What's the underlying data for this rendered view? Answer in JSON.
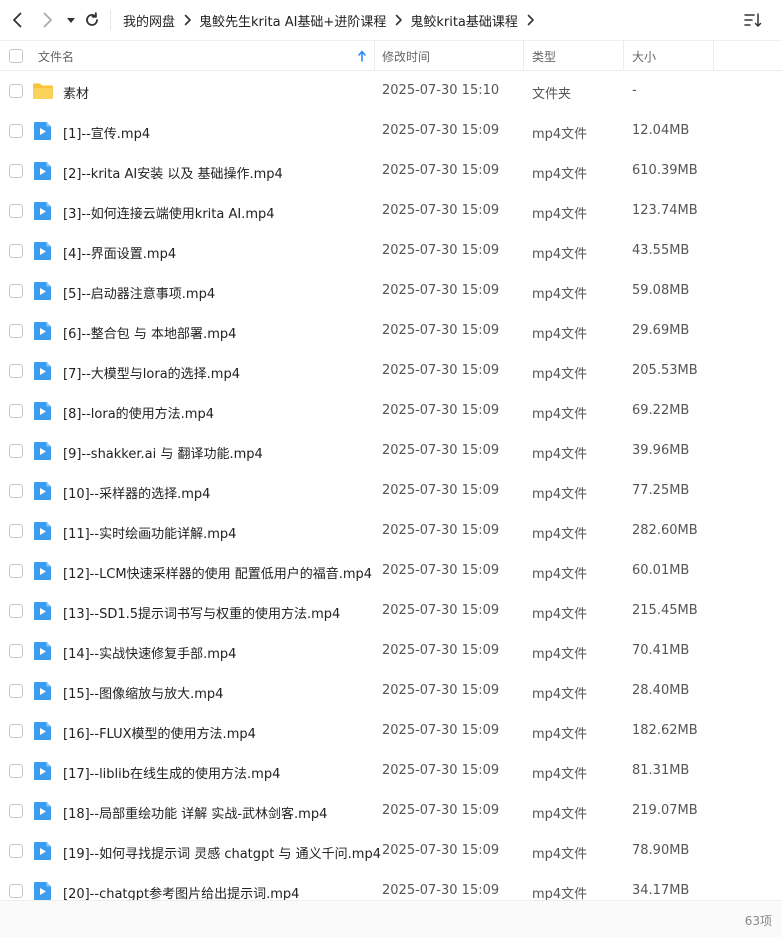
{
  "toolbar": {
    "breadcrumb": [
      "我的网盘",
      "鬼鲛先生krita AI基础+进阶课程",
      "鬼鲛krita基础课程"
    ]
  },
  "columns": {
    "name": "文件名",
    "date": "修改时间",
    "type": "类型",
    "size": "大小"
  },
  "files": [
    {
      "name": "素材",
      "date": "2025-07-30 15:10",
      "type": "文件夹",
      "size": "-",
      "icon": "folder-icon"
    },
    {
      "name": "[1]--宣传.mp4",
      "date": "2025-07-30 15:09",
      "type": "mp4文件",
      "size": "12.04MB",
      "icon": "video-file-icon"
    },
    {
      "name": "[2]--krita AI安装 以及 基础操作.mp4",
      "date": "2025-07-30 15:09",
      "type": "mp4文件",
      "size": "610.39MB",
      "icon": "video-file-icon"
    },
    {
      "name": "[3]--如何连接云端使用krita AI.mp4",
      "date": "2025-07-30 15:09",
      "type": "mp4文件",
      "size": "123.74MB",
      "icon": "video-file-icon"
    },
    {
      "name": "[4]--界面设置.mp4",
      "date": "2025-07-30 15:09",
      "type": "mp4文件",
      "size": "43.55MB",
      "icon": "video-file-icon"
    },
    {
      "name": "[5]--启动器注意事项.mp4",
      "date": "2025-07-30 15:09",
      "type": "mp4文件",
      "size": "59.08MB",
      "icon": "video-file-icon"
    },
    {
      "name": "[6]--整合包 与 本地部署.mp4",
      "date": "2025-07-30 15:09",
      "type": "mp4文件",
      "size": "29.69MB",
      "icon": "video-file-icon"
    },
    {
      "name": "[7]--大模型与lora的选择.mp4",
      "date": "2025-07-30 15:09",
      "type": "mp4文件",
      "size": "205.53MB",
      "icon": "video-file-icon"
    },
    {
      "name": "[8]--lora的使用方法.mp4",
      "date": "2025-07-30 15:09",
      "type": "mp4文件",
      "size": "69.22MB",
      "icon": "video-file-icon"
    },
    {
      "name": "[9]--shakker.ai 与 翻译功能.mp4",
      "date": "2025-07-30 15:09",
      "type": "mp4文件",
      "size": "39.96MB",
      "icon": "video-file-icon"
    },
    {
      "name": "[10]--采样器的选择.mp4",
      "date": "2025-07-30 15:09",
      "type": "mp4文件",
      "size": "77.25MB",
      "icon": "video-file-icon"
    },
    {
      "name": "[11]--实时绘画功能详解.mp4",
      "date": "2025-07-30 15:09",
      "type": "mp4文件",
      "size": "282.60MB",
      "icon": "video-file-icon"
    },
    {
      "name": "[12]--LCM快速采样器的使用 配置低用户的福音.mp4",
      "date": "2025-07-30 15:09",
      "type": "mp4文件",
      "size": "60.01MB",
      "icon": "video-file-icon"
    },
    {
      "name": "[13]--SD1.5提示词书写与权重的使用方法.mp4",
      "date": "2025-07-30 15:09",
      "type": "mp4文件",
      "size": "215.45MB",
      "icon": "video-file-icon"
    },
    {
      "name": "[14]--实战快速修复手部.mp4",
      "date": "2025-07-30 15:09",
      "type": "mp4文件",
      "size": "70.41MB",
      "icon": "video-file-icon"
    },
    {
      "name": "[15]--图像缩放与放大.mp4",
      "date": "2025-07-30 15:09",
      "type": "mp4文件",
      "size": "28.40MB",
      "icon": "video-file-icon"
    },
    {
      "name": "[16]--FLUX模型的使用方法.mp4",
      "date": "2025-07-30 15:09",
      "type": "mp4文件",
      "size": "182.62MB",
      "icon": "video-file-icon"
    },
    {
      "name": "[17]--liblib在线生成的使用方法.mp4",
      "date": "2025-07-30 15:09",
      "type": "mp4文件",
      "size": "81.31MB",
      "icon": "video-file-icon"
    },
    {
      "name": "[18]--局部重绘功能 详解 实战-武林剑客.mp4",
      "date": "2025-07-30 15:09",
      "type": "mp4文件",
      "size": "219.07MB",
      "icon": "video-file-icon"
    },
    {
      "name": "[19]--如何寻找提示词 灵感 chatgpt 与 通义千问.mp4",
      "date": "2025-07-30 15:09",
      "type": "mp4文件",
      "size": "78.90MB",
      "icon": "video-file-icon"
    },
    {
      "name": "[20]--chatgpt参考图片给出提示词.mp4",
      "date": "2025-07-30 15:09",
      "type": "mp4文件",
      "size": "34.17MB",
      "icon": "video-file-icon"
    }
  ],
  "status": {
    "item_count": "63项"
  },
  "colors": {
    "folder": "#F7C33A",
    "video": "#3C9DF0",
    "sort_arrow": "#2C8CF4"
  }
}
